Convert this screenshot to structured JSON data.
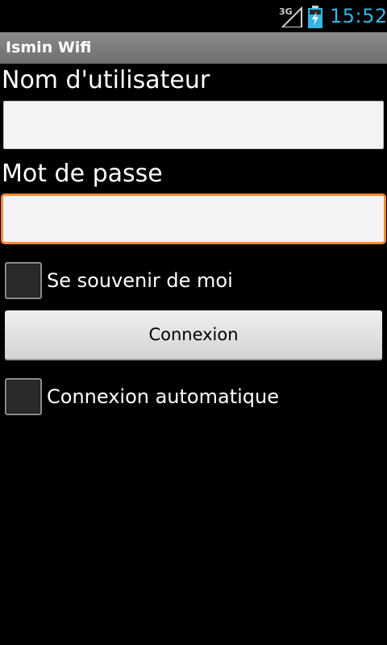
{
  "status_bar": {
    "network_type": "3G",
    "time": "15:52",
    "clock_color": "#33b5e5",
    "icons": [
      "signal-icon",
      "battery-charging-icon"
    ]
  },
  "title_bar": {
    "title": "Ismin Wifi"
  },
  "form": {
    "username_label": "Nom d'utilisateur",
    "username_value": "",
    "password_label": "Mot de passe",
    "password_value": "",
    "focus_color": "#ff8a2b",
    "remember_label": "Se souvenir de moi",
    "remember_checked": false,
    "connect_label": "Connexion",
    "auto_connect_label": "Connexion automatique",
    "auto_connect_checked": false
  }
}
